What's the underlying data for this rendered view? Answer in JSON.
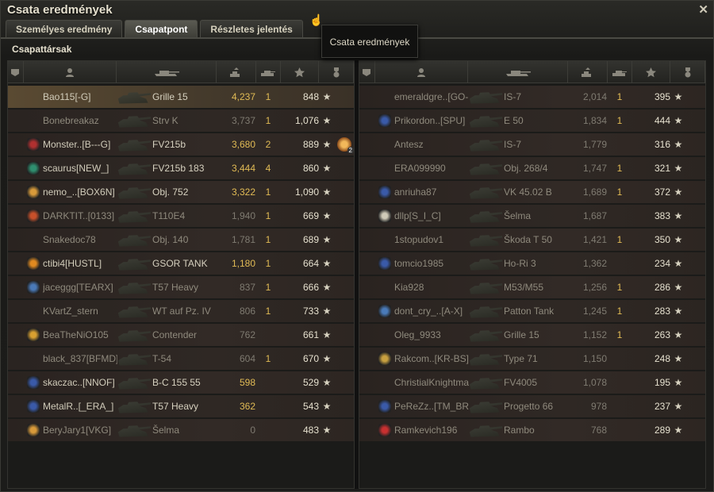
{
  "window": {
    "title": "Csata eredmények",
    "close_icon": "close-icon"
  },
  "tabs": [
    {
      "label": "Személyes eredmény",
      "active": false
    },
    {
      "label": "Csapatpont",
      "active": true
    },
    {
      "label": "Részletes jelentés",
      "active": false
    }
  ],
  "section_title": "Csapattársak",
  "tooltip": "Csata eredmények",
  "header_icons": [
    "platoon-icon",
    "player-icon",
    "tank-icon",
    "xp-icon",
    "kills-icon",
    "points-star-icon",
    "medal-icon"
  ],
  "left_team": [
    {
      "name": "Bao115[-G]",
      "tank": "Grille 15",
      "xp": "4,237",
      "kills": "1",
      "points": "848",
      "clan": "",
      "me": true,
      "dim": false,
      "medal": ""
    },
    {
      "name": "Bonebreakaz",
      "tank": "Strv K",
      "xp": "3,737",
      "kills": "1",
      "points": "1,076",
      "clan": "",
      "dim": true,
      "medal": ""
    },
    {
      "name": "Monster..[B---G]",
      "tank": "FV215b",
      "xp": "3,680",
      "kills": "2",
      "points": "889",
      "clan": "#b03030",
      "dim": false,
      "medal": "2"
    },
    {
      "name": "scaurus[NEW_]",
      "tank": "FV215b 183",
      "xp": "3,444",
      "kills": "4",
      "points": "860",
      "clan": "#2f8f6f",
      "dim": false,
      "medal": ""
    },
    {
      "name": "nemo_..[BOX6N]",
      "tank": "Obj. 752",
      "xp": "3,322",
      "kills": "1",
      "points": "1,090",
      "clan": "#d89a3a",
      "dim": false,
      "medal": ""
    },
    {
      "name": "DARKTIT..[0133]",
      "tank": "T110E4",
      "xp": "1,940",
      "kills": "1",
      "points": "669",
      "clan": "#c8502a",
      "dim": true,
      "medal": ""
    },
    {
      "name": "Snakedoc78",
      "tank": "Obj. 140",
      "xp": "1,781",
      "kills": "1",
      "points": "689",
      "clan": "",
      "dim": true,
      "medal": ""
    },
    {
      "name": "ctibi4[HUSTL]",
      "tank": "GSOR TANK",
      "xp": "1,180",
      "kills": "1",
      "points": "664",
      "clan": "#e08a20",
      "dim": false,
      "medal": ""
    },
    {
      "name": "jaceggg[TEARX]",
      "tank": "T57 Heavy",
      "xp": "837",
      "kills": "1",
      "points": "666",
      "clan": "#4a7ab8",
      "dim": true,
      "medal": ""
    },
    {
      "name": "KVartZ_stern",
      "tank": "WT auf Pz. IV",
      "xp": "806",
      "kills": "1",
      "points": "733",
      "clan": "",
      "dim": true,
      "medal": ""
    },
    {
      "name": "BeaTheNiO105",
      "tank": "Contender",
      "xp": "762",
      "kills": "",
      "points": "661",
      "clan": "#d8a030",
      "dim": true,
      "medal": ""
    },
    {
      "name": "black_837[BFMD]",
      "tank": "T-54",
      "xp": "604",
      "kills": "1",
      "points": "670",
      "clan": "",
      "dim": true,
      "medal": ""
    },
    {
      "name": "skaczac..[NNOF]",
      "tank": "B-C 155 55",
      "xp": "598",
      "kills": "",
      "points": "529",
      "clan": "#3a5aa8",
      "dim": false,
      "medal": ""
    },
    {
      "name": "MetalR..[_ERA_]",
      "tank": "T57 Heavy",
      "xp": "362",
      "kills": "",
      "points": "543",
      "clan": "#3a5aa8",
      "dim": false,
      "medal": ""
    },
    {
      "name": "BeryJary1[VKG]",
      "tank": "Šelma",
      "xp": "0",
      "kills": "",
      "points": "483",
      "clan": "#d89a3a",
      "dim": true,
      "medal": ""
    }
  ],
  "right_team": [
    {
      "name": "emeraldgre..[GO-MA]",
      "tank": "IS-7",
      "xp": "2,014",
      "kills": "1",
      "points": "395",
      "clan": "",
      "dim": true
    },
    {
      "name": "Prikordon..[SPU]",
      "tank": "E 50",
      "xp": "1,834",
      "kills": "1",
      "points": "444",
      "clan": "#3a5aa8",
      "dim": true
    },
    {
      "name": "Antesz",
      "tank": "IS-7",
      "xp": "1,779",
      "kills": "",
      "points": "316",
      "clan": "",
      "dim": true
    },
    {
      "name": "ERA099990",
      "tank": "Obj. 268/4",
      "xp": "1,747",
      "kills": "1",
      "points": "321",
      "clan": "",
      "dim": true
    },
    {
      "name": "anriuha87",
      "tank": "VK 45.02 B",
      "xp": "1,689",
      "kills": "1",
      "points": "372",
      "clan": "#3a5aa8",
      "dim": true
    },
    {
      "name": "dllp[S_I_C]",
      "tank": "Šelma",
      "xp": "1,687",
      "kills": "",
      "points": "383",
      "clan": "#cfcab8",
      "dim": true
    },
    {
      "name": "1stopudov1",
      "tank": "Škoda T 50",
      "xp": "1,421",
      "kills": "1",
      "points": "350",
      "clan": "",
      "dim": true
    },
    {
      "name": "tomcio1985",
      "tank": "Ho-Ri 3",
      "xp": "1,362",
      "kills": "",
      "points": "234",
      "clan": "#3a5aa8",
      "dim": true
    },
    {
      "name": "Kia928",
      "tank": "M53/M55",
      "xp": "1,256",
      "kills": "1",
      "points": "286",
      "clan": "",
      "dim": true
    },
    {
      "name": "dont_cry_..[A-X]",
      "tank": "Patton Tank",
      "xp": "1,245",
      "kills": "1",
      "points": "283",
      "clan": "#4a7ab8",
      "dim": true
    },
    {
      "name": "Oleg_9933",
      "tank": "Grille 15",
      "xp": "1,152",
      "kills": "1",
      "points": "263",
      "clan": "",
      "dim": true
    },
    {
      "name": "Rakcom..[KR-BS]",
      "tank": "Type 71",
      "xp": "1,150",
      "kills": "",
      "points": "248",
      "clan": "#c8a040",
      "dim": true
    },
    {
      "name": "ChristialKnightmare",
      "tank": "FV4005",
      "xp": "1,078",
      "kills": "",
      "points": "195",
      "clan": "",
      "dim": true
    },
    {
      "name": "PeReZz..[TM_BR]",
      "tank": "Progetto 66",
      "xp": "978",
      "kills": "",
      "points": "237",
      "clan": "#3a5aa8",
      "dim": true
    },
    {
      "name": "Ramkevich196",
      "tank": "Rambo",
      "xp": "768",
      "kills": "",
      "points": "289",
      "clan": "#c83030",
      "dim": true
    }
  ]
}
